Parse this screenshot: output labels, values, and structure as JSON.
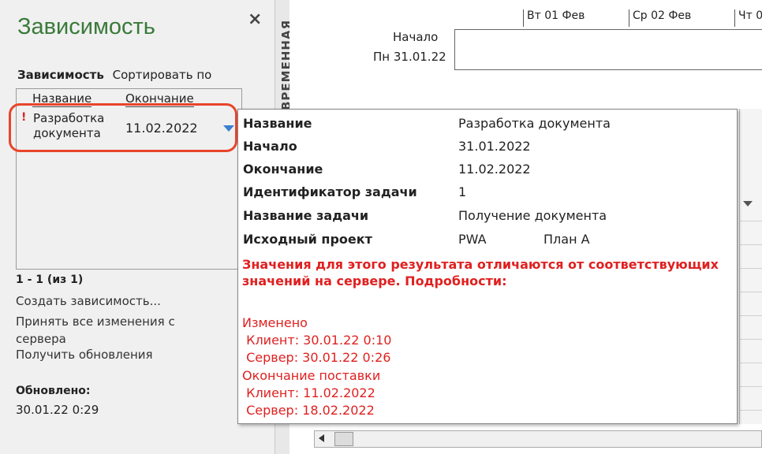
{
  "pane": {
    "title": "Зависимость",
    "close": "×",
    "sort_label": "Зависимость",
    "sort_by": "Сортировать по",
    "sort_options": [
      "Название",
      "Окончание"
    ],
    "item": {
      "flag": "!",
      "name": "Разработка документа",
      "end": "11.02.2022"
    },
    "count": "1 - 1 (из 1)",
    "links": [
      "Создать зависимость...",
      "Принять все изменения с сервера",
      "Получить обновления"
    ],
    "updated_label": "Обновлено:",
    "updated_value": "30.01.22 0:29"
  },
  "timeline": {
    "side_label": "ВРЕМЕННАЯ",
    "days": [
      "Вт 01 Фев",
      "Ср 02 Фев",
      "Чт 0"
    ],
    "start_label": "Начало",
    "start_date": "Пн 31.01.22"
  },
  "tooltip": {
    "fields": [
      {
        "label": "Название",
        "value": "Разработка документа"
      },
      {
        "label": "Начало",
        "value": "31.01.2022"
      },
      {
        "label": "Окончание",
        "value": "11.02.2022"
      },
      {
        "label": "Идентификатор задачи",
        "value": "1"
      },
      {
        "label": "Название задачи",
        "value": "Получение документа"
      },
      {
        "label": "Исходный проект",
        "value": "PWA",
        "value2": "План А"
      }
    ],
    "warning": "Значения для этого результата отличаются от соответствующих значений на сервере. Подробности:",
    "details": [
      "Изменено",
      " Клиент: 30.01.22 0:10",
      " Сервер: 30.01.22 0:26",
      "Окончание поставки",
      " Клиент: 11.02.2022",
      " Сервер: 18.02.2022"
    ]
  },
  "colors": {
    "title_green": "#3a7a3a",
    "warning_red": "#e02020",
    "highlight": "#e8452a",
    "accent_blue": "#3a7fd0"
  }
}
